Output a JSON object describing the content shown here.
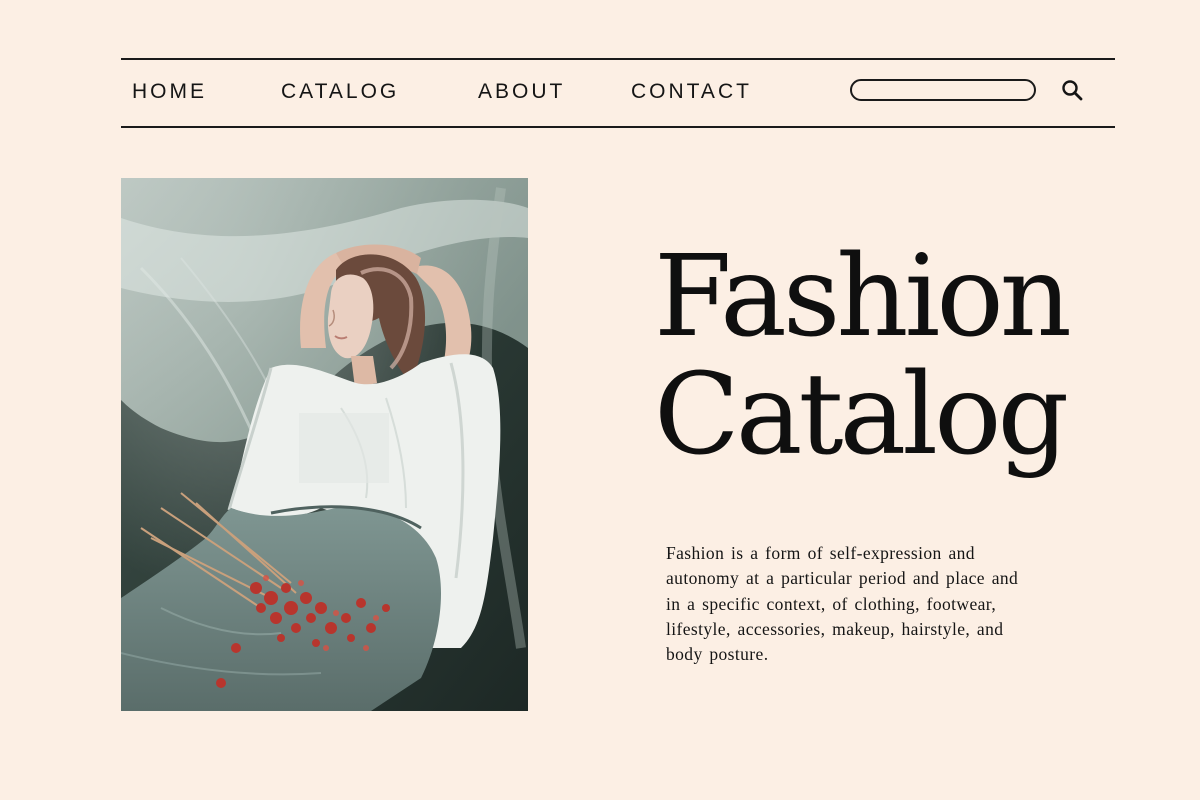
{
  "nav": {
    "links": [
      {
        "label": "HOME"
      },
      {
        "label": "CATALOG"
      },
      {
        "label": "ABOUT"
      },
      {
        "label": "CONTACT"
      }
    ],
    "search": {
      "value": "",
      "placeholder": ""
    },
    "search_icon": "search-icon"
  },
  "hero": {
    "image": "model-photo",
    "title_line1": "Fashion",
    "title_line2": "Catalog",
    "description": "Fashion is a form of self-expression and autonomy at a particular period and place and in a specific context, of clothing, footwear, lifestyle, accessories, makeup, hairstyle, and body posture."
  },
  "colors": {
    "background": "#fcefe4",
    "text": "#121212",
    "rule": "#1a1a1a"
  }
}
